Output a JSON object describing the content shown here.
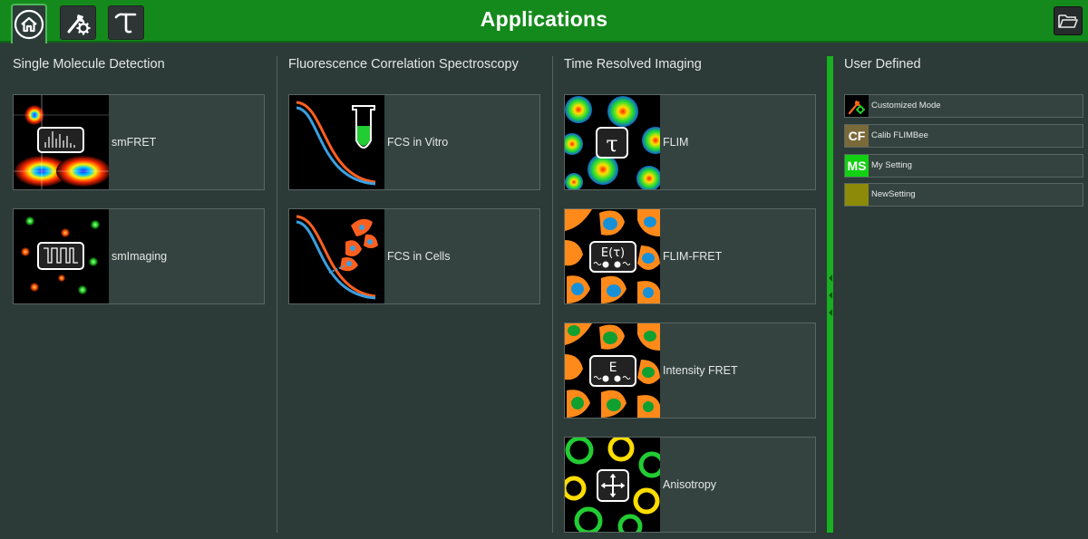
{
  "header": {
    "title": "Applications",
    "accent_color": "#158a1c",
    "buttons": [
      {
        "icon": "home-icon",
        "active": true
      },
      {
        "icon": "tools-icon"
      },
      {
        "icon": "tau-icon"
      },
      {
        "icon": "folder-icon"
      }
    ]
  },
  "columns": [
    {
      "title": "Single Molecule Detection",
      "tiles": [
        {
          "label": "smFRET",
          "icon": "smfret-icon"
        },
        {
          "label": "smImaging",
          "icon": "smimaging-icon"
        }
      ]
    },
    {
      "title": "Fluorescence Correlation Spectroscopy",
      "tiles": [
        {
          "label": "FCS in Vitro",
          "icon": "fcs-in-vitro-icon"
        },
        {
          "label": "FCS in Cells",
          "icon": "fcs-in-cells-icon"
        }
      ]
    },
    {
      "title": "Time Resolved Imaging",
      "tiles": [
        {
          "label": "FLIM",
          "icon": "flim-icon",
          "overlay": "τ"
        },
        {
          "label": "FLIM-FRET",
          "icon": "flim-fret-icon",
          "overlay": "E(τ)"
        },
        {
          "label": "Intensity FRET",
          "icon": "intensity-fret-icon",
          "overlay": "E"
        },
        {
          "label": "Anisotropy",
          "icon": "anisotropy-icon"
        }
      ]
    }
  ],
  "user_defined": {
    "title": "User Defined",
    "items": [
      {
        "label": "Customized Mode",
        "icon": "customized-mode-icon",
        "badge": ""
      },
      {
        "label": "Calib FLIMBee",
        "icon": "cf-badge-icon",
        "badge": "CF",
        "color": "#7a6a3a"
      },
      {
        "label": "My Setting",
        "icon": "ms-badge-icon",
        "badge": "MS",
        "color": "#12d012"
      },
      {
        "label": "NewSetting",
        "icon": "color-swatch-icon",
        "badge": "",
        "color": "#8c8a08"
      }
    ]
  }
}
